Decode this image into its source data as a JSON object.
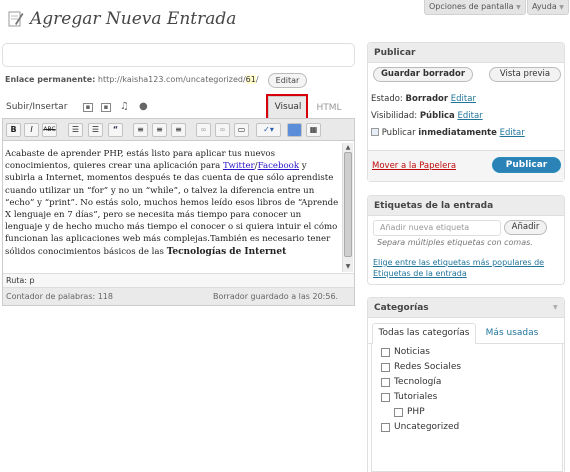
{
  "header": {
    "title": "Agregar Nueva Entrada",
    "screen_options": "Opciones de pantalla",
    "help": "Ayuda"
  },
  "permalink": {
    "label": "Enlace permanente:",
    "url_prefix": "http://kaisha123.com/uncategorized/",
    "slug": "61",
    "url_suffix": "/",
    "edit_button": "Editar"
  },
  "editor": {
    "upload_label": "Subir/Insertar",
    "tab_visual": "Visual",
    "tab_html": "HTML",
    "path_label": "Ruta: p",
    "word_count": "Contador de palabras: 118",
    "draft_saved": "Borrador guardado a las 20:56.",
    "content": {
      "p1a": "Acabaste de aprender PHP, estás listo para aplicar tus nuevos conocimientos, quieres crear una aplicación para ",
      "link1": "Twitter",
      "sep": "/",
      "link2": "Facebook",
      "p1b": " y subirla a Internet, momentos después te das cuenta de que sólo aprendiste cuando utilizar un “for” y no un “while”, o talvez la diferencia entre un “echo” y “print”. No estás solo, muchos hemos leído esos libros de “Aprende X lenguaje en 7 días”, pero se necesita más tiempo para conocer un lenguaje y de hecho mucho más tiempo el conocer o si quiera intuir el cómo funcionan las aplicaciones web más complejas.También es necesario tener sólidos conocimientos básicos de las ",
      "bold": "Tecnologías de Internet"
    }
  },
  "publish": {
    "title": "Publicar",
    "save_draft": "Guardar borrador",
    "preview": "Vista previa",
    "status_label": "Estado:",
    "status_value": "Borrador",
    "visibility_label": "Visibilidad:",
    "visibility_value": "Pública",
    "publish_label": "Publicar",
    "publish_value": "inmediatamente",
    "edit": "Editar",
    "trash": "Mover a la Papelera",
    "publish_button": "Publicar"
  },
  "tags": {
    "title": "Etiquetas de la entrada",
    "placeholder": "Añadir nueva etiqueta",
    "add_button": "Añadir",
    "hint": "Separa múltiples etiquetas con comas.",
    "popular_link": "Elige entre las etiquetas más populares de Etiquetas de la entrada"
  },
  "categories": {
    "title": "Categorías",
    "tab_all": "Todas las categorías",
    "tab_popular": "Más usadas",
    "items": [
      {
        "label": "Noticias"
      },
      {
        "label": "Redes Sociales"
      },
      {
        "label": "Tecnología"
      },
      {
        "label": "Tutoriales"
      },
      {
        "label": "PHP"
      },
      {
        "label": "Uncategorized"
      }
    ]
  },
  "colors": {
    "accent": "#21759b",
    "publish_button": "#2a82b7",
    "highlight": "#d6000c",
    "trash": "#bc0b0b"
  }
}
